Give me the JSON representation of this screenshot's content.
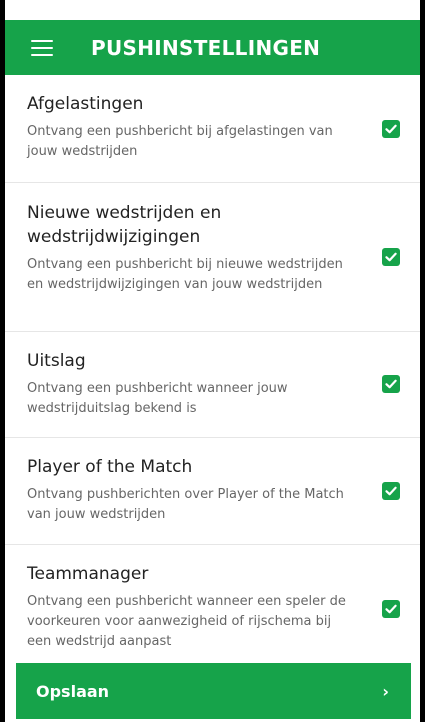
{
  "header": {
    "title": "PUSHINSTELLINGEN"
  },
  "settings": [
    {
      "title": "Afgelastingen",
      "description": "Ontvang een pushbericht bij afgelastingen van jouw wedstrijden",
      "checked": true
    },
    {
      "title": "Nieuwe wedstrijden en wedstrijdwijzigingen",
      "description": "Ontvang een pushbericht bij nieuwe wedstrijden en wedstrijdwijzigingen van jouw wedstrijden",
      "checked": true
    },
    {
      "title": "Uitslag",
      "description": "Ontvang een pushbericht wanneer jouw wedstrijduitslag bekend is",
      "checked": true
    },
    {
      "title": "Player of the Match",
      "description": "Ontvang pushberichten over Player of the Match van jouw wedstrijden",
      "checked": true
    },
    {
      "title": "Teammanager",
      "description": "Ontvang een pushbericht wanneer een speler de voorkeuren voor aanwezigheid of rijschema bij een wedstrijd aanpast",
      "checked": true
    }
  ],
  "footer": {
    "save_label": "Opslaan",
    "chevron": "›"
  },
  "colors": {
    "accent": "#16a34a",
    "text": "#222222",
    "muted": "#666666"
  }
}
